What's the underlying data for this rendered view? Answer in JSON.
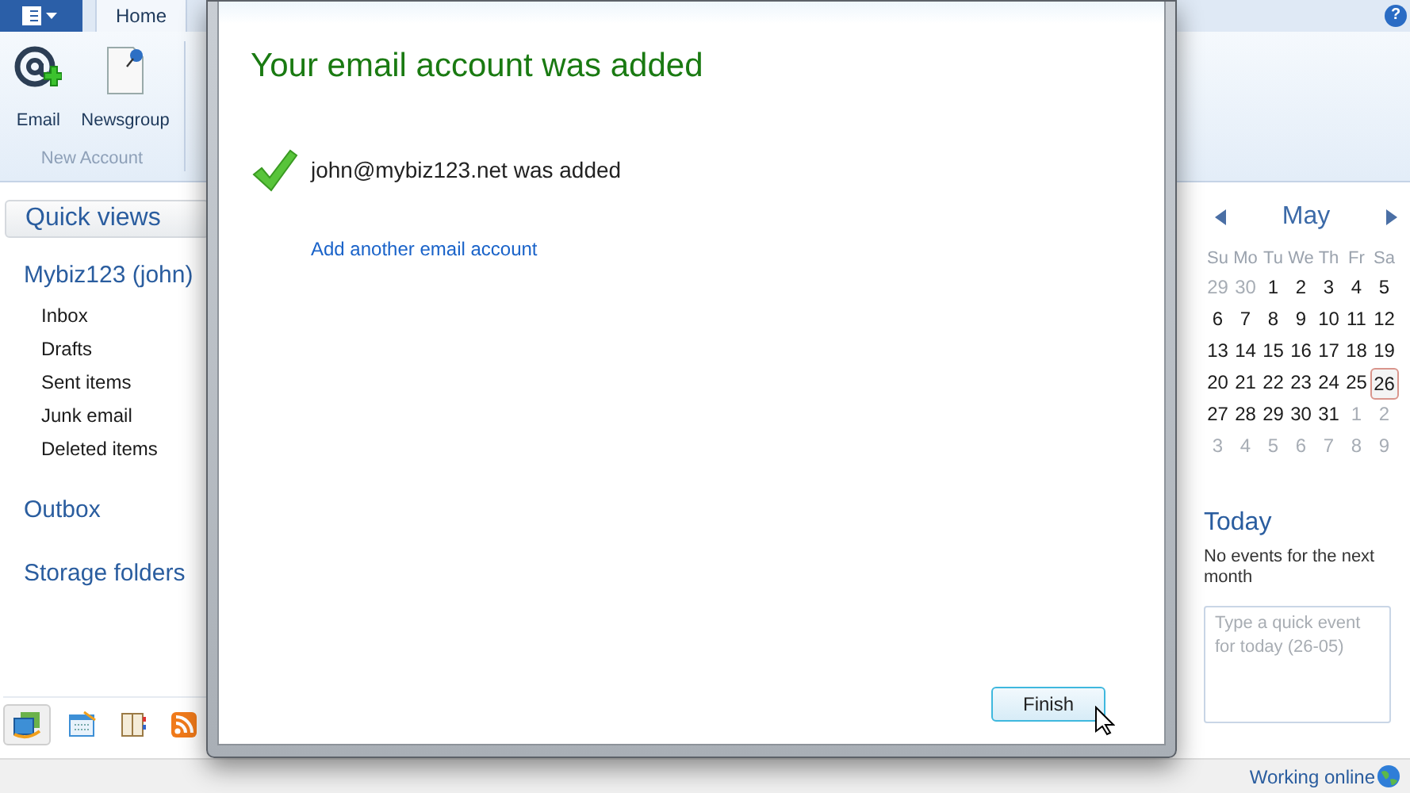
{
  "ribbon": {
    "tabs": [
      {
        "label": "Home",
        "selected": true
      }
    ],
    "groups": [
      {
        "title": "New Account",
        "buttons": [
          {
            "label": "Email",
            "kind": "email"
          },
          {
            "label": "Newsgroup",
            "kind": "newsgroup"
          }
        ]
      }
    ],
    "help": "?"
  },
  "sidebar": {
    "header": "Quick views",
    "account": "Mybiz123 (john)",
    "folders": [
      "Inbox",
      "Drafts",
      "Sent items",
      "Junk email",
      "Deleted items"
    ],
    "sections": [
      "Outbox",
      "Storage folders"
    ],
    "nav": [
      {
        "kind": "mail",
        "selected": true
      },
      {
        "kind": "calendar",
        "selected": false
      },
      {
        "kind": "contacts",
        "selected": false
      },
      {
        "kind": "feeds",
        "selected": false
      }
    ]
  },
  "dialog": {
    "title": "Your email account was added",
    "message": "john@mybiz123.net was added",
    "link": "Add another email account",
    "button": "Finish"
  },
  "calendar": {
    "month": "May",
    "weekdays": [
      "Su",
      "Mo",
      "Tu",
      "We",
      "Th",
      "Fr",
      "Sa"
    ],
    "weeks": [
      [
        {
          "label": "29",
          "other_month": true,
          "selected": false
        },
        {
          "label": "30",
          "other_month": true,
          "selected": false
        },
        {
          "label": "1",
          "other_month": false,
          "selected": false
        },
        {
          "label": "2",
          "other_month": false,
          "selected": false
        },
        {
          "label": "3",
          "other_month": false,
          "selected": false
        },
        {
          "label": "4",
          "other_month": false,
          "selected": false
        },
        {
          "label": "5",
          "other_month": false,
          "selected": false
        }
      ],
      [
        {
          "label": "6",
          "other_month": false,
          "selected": false
        },
        {
          "label": "7",
          "other_month": false,
          "selected": false
        },
        {
          "label": "8",
          "other_month": false,
          "selected": false
        },
        {
          "label": "9",
          "other_month": false,
          "selected": false
        },
        {
          "label": "10",
          "other_month": false,
          "selected": false
        },
        {
          "label": "11",
          "other_month": false,
          "selected": false
        },
        {
          "label": "12",
          "other_month": false,
          "selected": false
        }
      ],
      [
        {
          "label": "13",
          "other_month": false,
          "selected": false
        },
        {
          "label": "14",
          "other_month": false,
          "selected": false
        },
        {
          "label": "15",
          "other_month": false,
          "selected": false
        },
        {
          "label": "16",
          "other_month": false,
          "selected": false
        },
        {
          "label": "17",
          "other_month": false,
          "selected": false
        },
        {
          "label": "18",
          "other_month": false,
          "selected": false
        },
        {
          "label": "19",
          "other_month": false,
          "selected": false
        }
      ],
      [
        {
          "label": "20",
          "other_month": false,
          "selected": false
        },
        {
          "label": "21",
          "other_month": false,
          "selected": false
        },
        {
          "label": "22",
          "other_month": false,
          "selected": false
        },
        {
          "label": "23",
          "other_month": false,
          "selected": false
        },
        {
          "label": "24",
          "other_month": false,
          "selected": false
        },
        {
          "label": "25",
          "other_month": false,
          "selected": false
        },
        {
          "label": "26",
          "other_month": false,
          "selected": true
        }
      ],
      [
        {
          "label": "27",
          "other_month": false,
          "selected": false
        },
        {
          "label": "28",
          "other_month": false,
          "selected": false
        },
        {
          "label": "29",
          "other_month": false,
          "selected": false
        },
        {
          "label": "30",
          "other_month": false,
          "selected": false
        },
        {
          "label": "31",
          "other_month": false,
          "selected": false
        },
        {
          "label": "1",
          "other_month": true,
          "selected": false
        },
        {
          "label": "2",
          "other_month": true,
          "selected": false
        }
      ],
      [
        {
          "label": "3",
          "other_month": true,
          "selected": false
        },
        {
          "label": "4",
          "other_month": true,
          "selected": false
        },
        {
          "label": "5",
          "other_month": true,
          "selected": false
        },
        {
          "label": "6",
          "other_month": true,
          "selected": false
        },
        {
          "label": "7",
          "other_month": true,
          "selected": false
        },
        {
          "label": "8",
          "other_month": true,
          "selected": false
        },
        {
          "label": "9",
          "other_month": true,
          "selected": false
        }
      ]
    ]
  },
  "today": {
    "title": "Today",
    "message": "No events for the next month",
    "placeholder": "Type a quick event for today (26-05)"
  },
  "status_bar": {
    "text": "Working online"
  }
}
